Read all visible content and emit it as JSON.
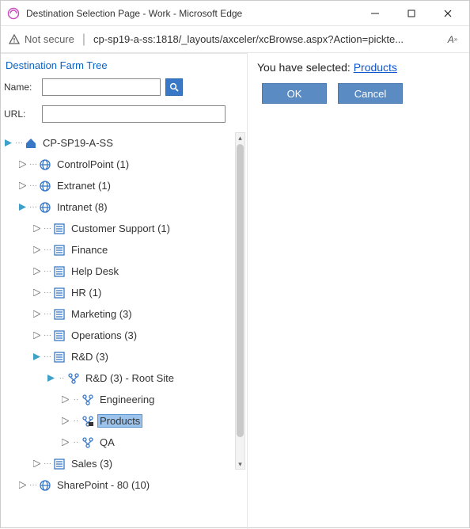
{
  "window": {
    "title": "Destination Selection Page - Work - Microsoft Edge"
  },
  "address": {
    "not_secure": "Not secure",
    "separator": "|",
    "url": "cp-sp19-a-ss:1818/_layouts/axceler/xcBrowse.aspx?Action=pickte...",
    "read_aloud_hint": "A⁀"
  },
  "left": {
    "panel_title": "Destination Farm Tree",
    "name_label": "Name:",
    "name_value": "",
    "url_label": "URL:",
    "url_value": ""
  },
  "tree": {
    "root": "CP-SP19-A-SS",
    "n_controlpoint": "ControlPoint (1)",
    "n_extranet": "Extranet (1)",
    "n_intranet": "Intranet (8)",
    "n_cs": "Customer Support (1)",
    "n_finance": "Finance",
    "n_helpdesk": "Help Desk",
    "n_hr": "HR (1)",
    "n_marketing": "Marketing (3)",
    "n_operations": "Operations (3)",
    "n_rd": "R&D (3)",
    "n_rd_root": "R&D (3) - Root Site",
    "n_engineering": "Engineering",
    "n_products": "Products",
    "n_qa": "QA",
    "n_sales": "Sales (3)",
    "n_sharepoint": "SharePoint - 80 (10)"
  },
  "right": {
    "prefix": "You have selected: ",
    "selected": "Products",
    "ok": "OK",
    "cancel": "Cancel"
  }
}
